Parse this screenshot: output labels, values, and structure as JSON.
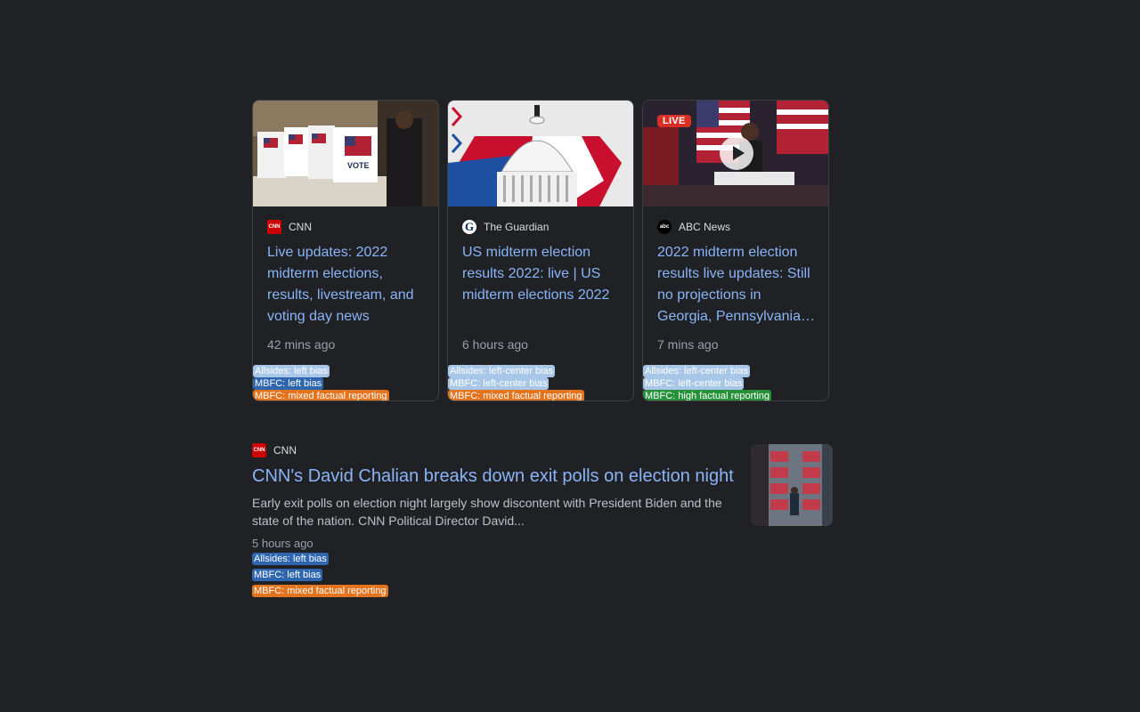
{
  "cards": [
    {
      "source": "CNN",
      "favicon_text": "CNN",
      "title": "Live updates: 2022 midterm elections, results, livestream, and voting day news",
      "time": "42 mins ago",
      "badges": [
        "Allsides: left bias",
        "MBFC: left bias",
        "MBFC: mixed factual reporting"
      ]
    },
    {
      "source": "The Guardian",
      "favicon_text": "G",
      "title": "US midterm election results 2022: live | US midterm elections 2022",
      "time": "6 hours ago",
      "badges": [
        "Allsides: left-center bias",
        "MBFC: left-center bias",
        "MBFC: mixed factual reporting"
      ]
    },
    {
      "source": "ABC News",
      "favicon_text": "abc",
      "live_label": "LIVE",
      "title": "2022 midterm election results live updates: Still no projections in Georgia, Pennsylvania…",
      "time": "7 mins ago",
      "badges": [
        "Allsides: left-center bias",
        "MBFC: left-center bias",
        "MBFC: high factual reporting"
      ]
    }
  ],
  "article": {
    "source": "CNN",
    "favicon_text": "CNN",
    "title": "CNN's David Chalian breaks down exit polls on election night",
    "snippet": "Early exit polls on election night largely show discontent with President Biden and the state of the nation. CNN Political Director David...",
    "time": "5 hours ago",
    "badges": [
      "Allsides: left bias",
      "MBFC: left bias",
      "MBFC: mixed factual reporting"
    ]
  },
  "colors": {
    "background": "#202124",
    "link": "#8ab4f8",
    "badge_light_blue": "#a8c7e8",
    "badge_blue": "#2e66b0",
    "badge_orange": "#e3731c",
    "badge_green": "#27913a",
    "live_red": "#d93025"
  }
}
